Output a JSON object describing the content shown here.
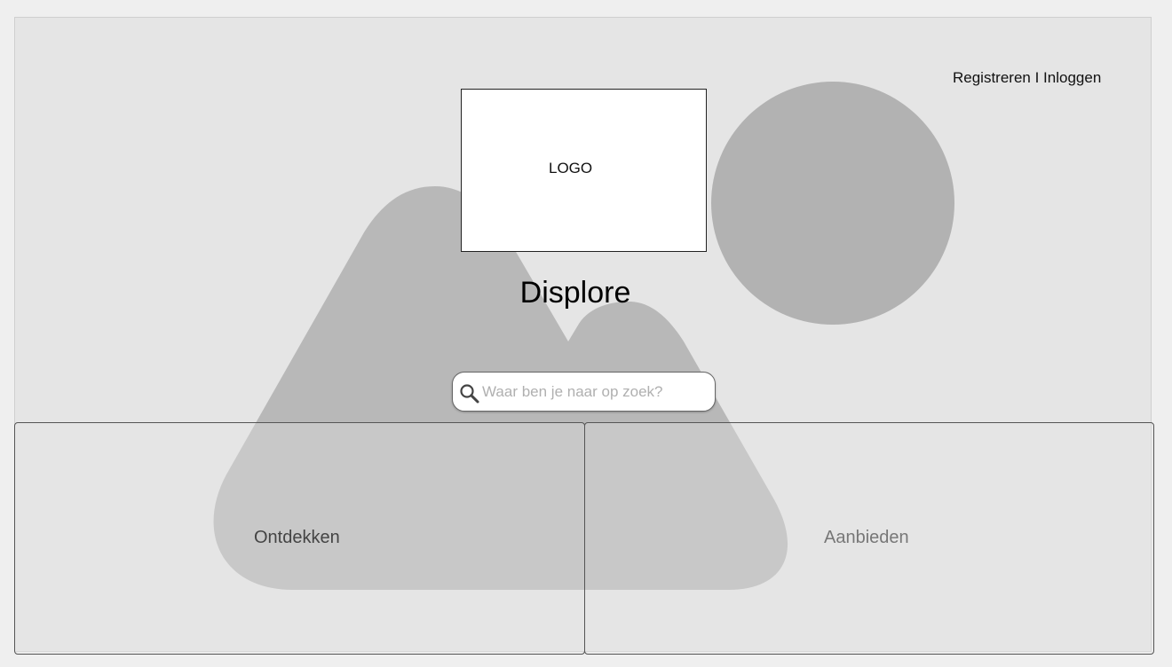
{
  "header": {
    "auth_links": "Registreren I Inloggen"
  },
  "logo": {
    "text": "LOGO"
  },
  "site": {
    "title": "Displore"
  },
  "search": {
    "placeholder": "Waar ben je naar op zoek?",
    "value": "",
    "icon": "search-icon"
  },
  "panels": [
    {
      "label": "Ontdekken"
    },
    {
      "label": "Aanbieden"
    }
  ],
  "colors": {
    "background": "#e5e5e5",
    "placeholder_shape": "#b2b2b2",
    "panel_border": "#555555"
  }
}
